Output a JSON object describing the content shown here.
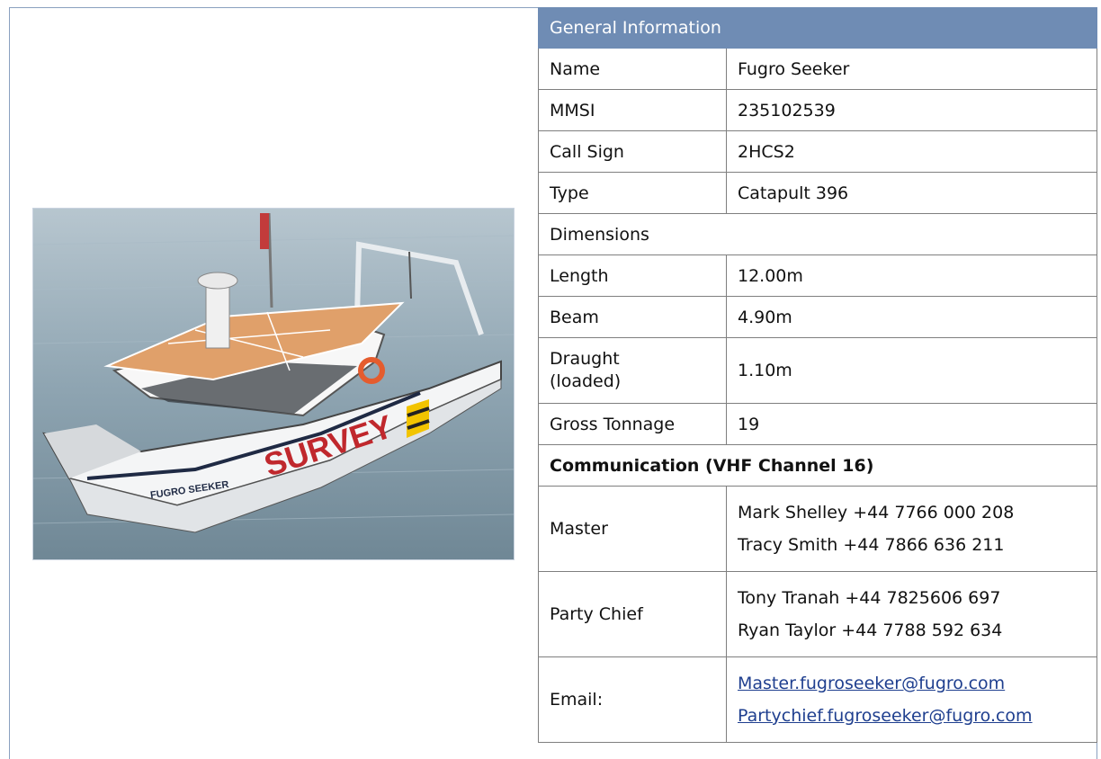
{
  "section_title": "General Information",
  "general": [
    {
      "label": "Name",
      "value": "Fugro Seeker"
    },
    {
      "label": "MMSI",
      "value": "235102539"
    },
    {
      "label": "Call Sign",
      "value": "2HCS2"
    },
    {
      "label": "Type",
      "value": "Catapult 396"
    }
  ],
  "dimensions_title": "Dimensions",
  "dimensions": [
    {
      "label": "Length",
      "value": "12.00m"
    },
    {
      "label": "Beam",
      "value": "4.90m"
    },
    {
      "label": "Draught_1",
      "value": "Draught"
    },
    {
      "label": "Draught_2",
      "value": "(loaded)"
    },
    {
      "label": "Draught_val",
      "value": "1.10m"
    },
    {
      "label": "Gross Tonnage",
      "value": "19"
    }
  ],
  "communication_title": "Communication (VHF Channel 16)",
  "master": {
    "label": "Master",
    "lines": [
      "Mark Shelley +44 7766 000 208",
      "Tracy Smith +44 7866 636 211"
    ]
  },
  "party_chief": {
    "label": "Party Chief",
    "lines": [
      "Tony Tranah +44 7825606 697",
      "Ryan Taylor +44 7788 592 634"
    ]
  },
  "email": {
    "label": "Email:",
    "lines": [
      "Master.fugroseeker@fugro.com",
      "Partychief.fugroseeker@fugro.com"
    ]
  },
  "photo": {
    "hull_text": "SURVEY",
    "name_text": "FUGRO SEEKER"
  }
}
